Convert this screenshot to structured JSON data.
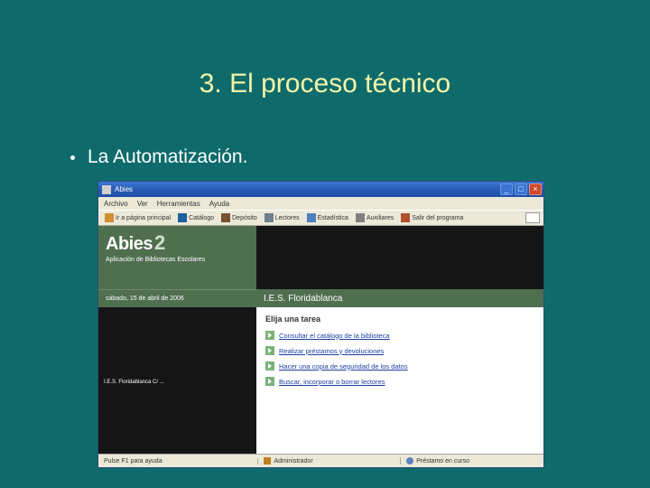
{
  "slide": {
    "title": "3. El proceso técnico",
    "bullet": "La Automatización."
  },
  "window": {
    "title": "Abies",
    "controls": {
      "min": "_",
      "max": "□",
      "close": "×"
    },
    "menu": [
      "Archivo",
      "Ver",
      "Herramientas",
      "Ayuda"
    ],
    "toolbar": {
      "home": "Ir a página principal",
      "catalog": "Catálogo",
      "deposit": "Depósito",
      "readers": "Lectores",
      "stats": "Estadística",
      "aux": "Auxiliares",
      "exit": "Salir del programa"
    },
    "brand": {
      "name": "Abies",
      "ver": "2",
      "sub": "Aplicación de Bibliotecas Escolares"
    },
    "date": "sábado, 15 de abril de 2006",
    "school": "I.E.S. Floridablanca",
    "info": "I.E.S. Floridablanca\nC/ ...",
    "task_heading": "Elija una tarea",
    "tasks": [
      "Consultar el catálogo de la biblioteca",
      "Realizar préstamos y devoluciones",
      "Hacer una copia de seguridad de los datos",
      "Buscar, incorporar o borrar lectores"
    ],
    "status": {
      "help": "Pulse F1 para ayuda",
      "user": "Administrador",
      "clock": "Préstamo en curso"
    }
  }
}
